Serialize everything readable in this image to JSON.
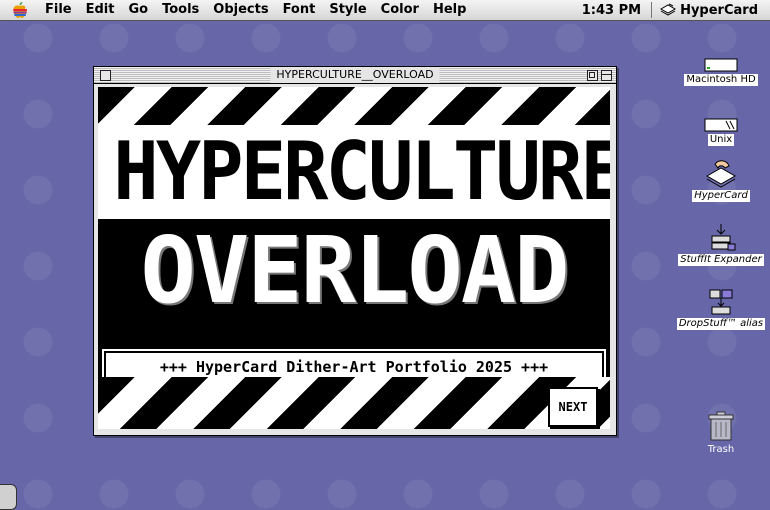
{
  "menubar": {
    "apple_icon": "apple-icon",
    "items": [
      "File",
      "Edit",
      "Go",
      "Tools",
      "Objects",
      "Font",
      "Style",
      "Color",
      "Help"
    ],
    "clock": "1:43 PM",
    "app_name": "HyperCard"
  },
  "window": {
    "title": "HYPERCULTURE__OVERLOAD"
  },
  "card": {
    "title_line1": "HYPERCULTURE",
    "title_line2": "OVERLOAD",
    "banner_text": "+++ HyperCard Dither-Art Portfolio 2025 +++",
    "next_label": "NEXT"
  },
  "desktop": {
    "icons": [
      {
        "label": "Macintosh HD",
        "icon": "hard-drive-icon"
      },
      {
        "label": "Unix",
        "icon": "disk-icon"
      },
      {
        "label": "HyperCard",
        "icon": "hypercard-icon"
      },
      {
        "label": "StuffIt Expander",
        "icon": "stuffit-icon"
      },
      {
        "label": "DropStuff™ alias",
        "icon": "dropstuff-icon"
      },
      {
        "label": "Trash",
        "icon": "trash-icon"
      }
    ]
  },
  "colors": {
    "desktop": "#6666a8",
    "card_ink": "#000000",
    "card_paper": "#ffffff"
  }
}
